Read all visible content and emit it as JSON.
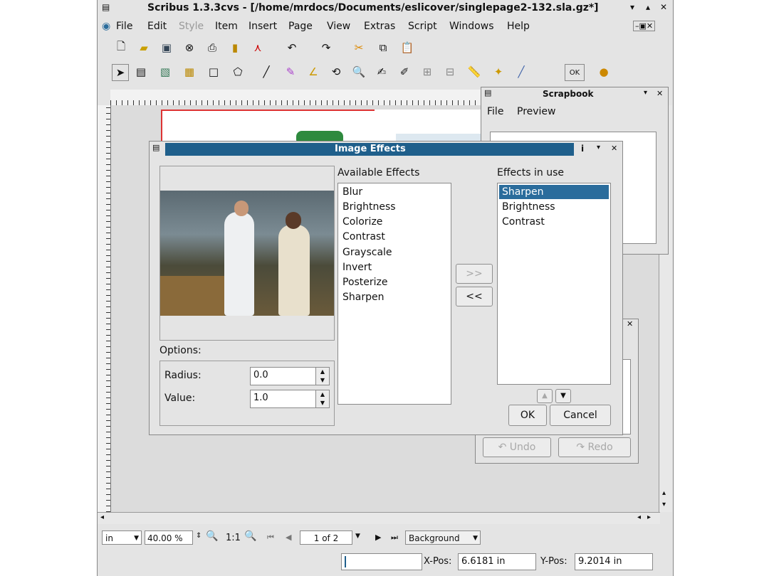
{
  "window": {
    "title": "Scribus 1.3.3cvs - [/home/mrdocs/Documents/eslicover/singlepage2-132.sla.gz*]"
  },
  "menubar": {
    "items": [
      "File",
      "Edit",
      "Style",
      "Item",
      "Insert",
      "Page",
      "View",
      "Extras",
      "Script",
      "Windows",
      "Help"
    ]
  },
  "scrapbook": {
    "title": "Scrapbook",
    "menu": [
      "File",
      "Preview"
    ]
  },
  "undo_panel": {
    "undo_label": "Undo",
    "redo_label": "Redo"
  },
  "dialog": {
    "title": "Image Effects",
    "available_label": "Available Effects",
    "available_effects": [
      "Blur",
      "Brightness",
      "Colorize",
      "Contrast",
      "Grayscale",
      "Invert",
      "Posterize",
      "Sharpen"
    ],
    "in_use_label": "Effects in use",
    "effects_in_use": [
      "Sharpen",
      "Brightness",
      "Contrast"
    ],
    "selected_in_use": "Sharpen",
    "add_button": ">>",
    "remove_button": "<<",
    "options_label": "Options:",
    "radius_label": "Radius:",
    "radius_value": "0.0",
    "value_label": "Value:",
    "value_value": "1.0",
    "ok_label": "OK",
    "cancel_label": "Cancel"
  },
  "bottom_bar": {
    "unit": "in",
    "zoom": "40.00 %",
    "one_to_one": "1:1",
    "page": "1 of 2",
    "layer": "Background"
  },
  "status": {
    "xpos_label": "X-Pos:",
    "xpos_value": "6.6181 in",
    "ypos_label": "Y-Pos:",
    "ypos_value": "9.2014 in"
  },
  "colors": {
    "dialog_title_bg": "#1f5f8b",
    "selection": "#2a6c9c",
    "page_border": "#dd3333"
  }
}
